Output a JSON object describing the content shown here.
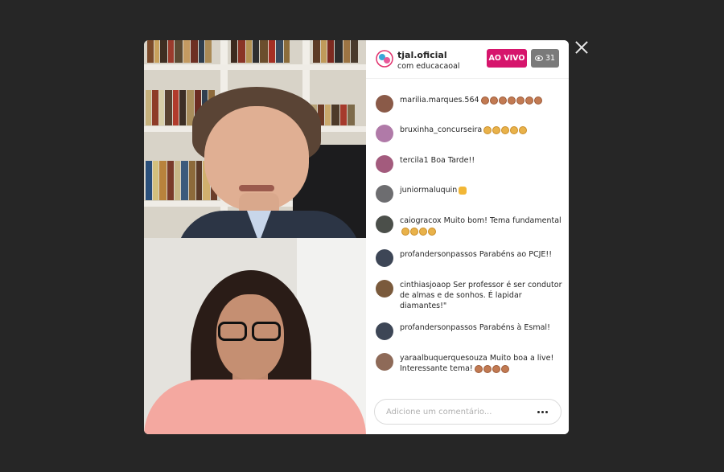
{
  "header": {
    "host_name": "tjal.oficial",
    "host_sub": "com educacaoal",
    "live_label": "AO VIVO",
    "viewer_count": "31"
  },
  "comments": [
    {
      "user": "marilia.marques.564",
      "text": "",
      "avatar_color": "#8a5a48",
      "emoji": [
        "clap-dark",
        "clap-dark",
        "clap-dark",
        "clap-dark",
        "clap-dark",
        "clap-dark",
        "clap-dark"
      ]
    },
    {
      "user": "bruxinha_concurseira",
      "text": "",
      "avatar_color": "#b07aa8",
      "emoji": [
        "clap",
        "clap",
        "clap",
        "clap",
        "clap"
      ]
    },
    {
      "user": "tercila1",
      "text": "Boa Tarde!!",
      "avatar_color": "#a35b7d",
      "emoji": []
    },
    {
      "user": "juniormaluquin",
      "text": "",
      "avatar_color": "#6d6d70",
      "emoji": [
        "thumb"
      ]
    },
    {
      "user": "caiogracox",
      "text": "Muito bom! Tema fundamental",
      "avatar_color": "#4b4f4a",
      "emoji": [
        "clap",
        "clap",
        "clap",
        "clap"
      ]
    },
    {
      "user": "profandersonpassos",
      "text": "Parabéns ao PCJE!!",
      "avatar_color": "#3d4656",
      "emoji": []
    },
    {
      "user": "cinthiasjoaop",
      "text": "Ser professor é ser condutor de almas e de sonhos. É lapidar diamantes!\"",
      "avatar_color": "#7a5a3c",
      "emoji": []
    },
    {
      "user": "profandersonpassos",
      "text": "Parabéns à Esmal!",
      "avatar_color": "#3d4656",
      "emoji": []
    },
    {
      "user": "yaraalbuquerquesouza",
      "text": "Muito boa a live! Interessante tema!",
      "avatar_color": "#8e6a58",
      "emoji": [
        "clap-dark",
        "clap-dark",
        "clap-dark",
        "clap-dark"
      ]
    }
  ],
  "input": {
    "placeholder": "Adicione um comentário..."
  },
  "colors": {
    "live_badge": "#d6156c",
    "viewer_badge": "#7a7a7a",
    "backdrop": "#262626"
  },
  "icons": {
    "close": "close-icon",
    "viewers": "eye-icon",
    "more": "more-options-icon"
  }
}
